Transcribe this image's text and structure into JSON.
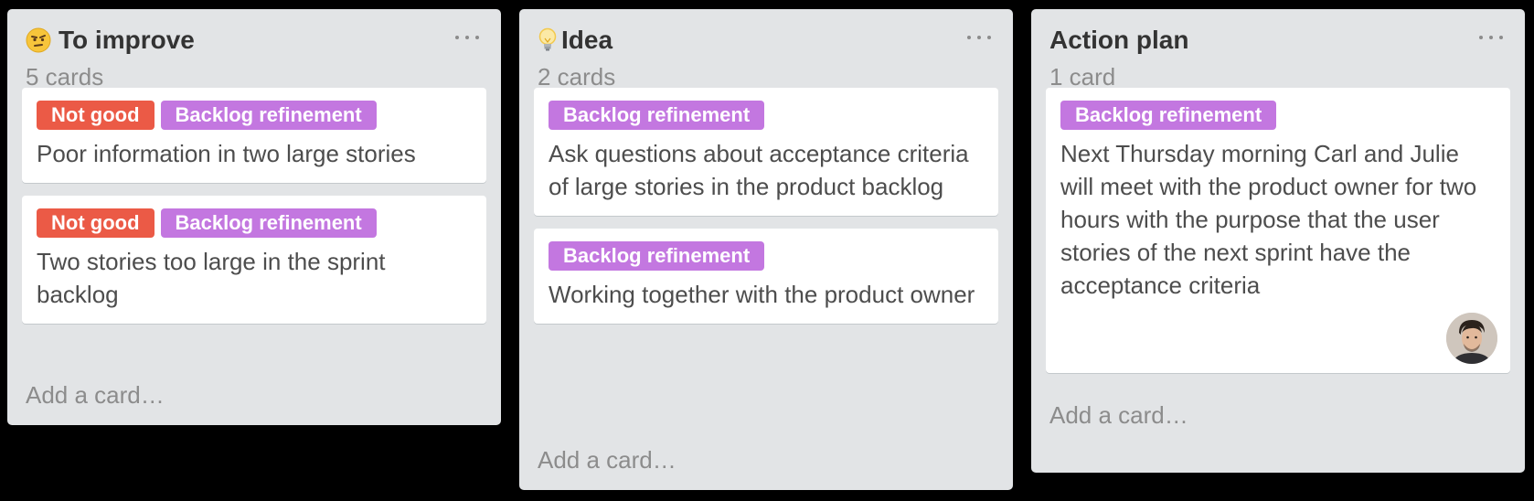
{
  "lists": [
    {
      "title": "To improve",
      "icon": "unimpressed-face-icon",
      "count": "5 cards",
      "cards": [
        {
          "labels": [
            {
              "text": "Not good",
              "color": "#eb5a46"
            },
            {
              "text": "Backlog refinement",
              "color": "#c377e0"
            }
          ],
          "text": "Poor information in two large stories"
        },
        {
          "labels": [
            {
              "text": "Not good",
              "color": "#eb5a46"
            },
            {
              "text": "Backlog refinement",
              "color": "#c377e0"
            }
          ],
          "text": "Two stories too large in the sprint backlog"
        }
      ],
      "add_card": "Add a card…"
    },
    {
      "title": "Idea",
      "icon": "lightbulb-icon",
      "count": "2 cards",
      "cards": [
        {
          "labels": [
            {
              "text": "Backlog refinement",
              "color": "#c377e0"
            }
          ],
          "text": "Ask questions about acceptance criteria of large stories in the product backlog"
        },
        {
          "labels": [
            {
              "text": "Backlog refinement",
              "color": "#c377e0"
            }
          ],
          "text": "Working together with the product owner"
        }
      ],
      "add_card": "Add a card…"
    },
    {
      "title": "Action plan",
      "icon": "",
      "count": "1 card",
      "cards": [
        {
          "labels": [
            {
              "text": "Backlog refinement",
              "color": "#c377e0"
            }
          ],
          "text": "Next Thursday morning Carl and Julie will meet with the product owner for two hours with the purpose that the user stories of the next sprint have the acceptance criteria",
          "avatar": "member-avatar"
        }
      ],
      "add_card": "Add a card…"
    }
  ],
  "colors": {
    "list_bg": "#e2e4e6",
    "label_red": "#eb5a46",
    "label_purple": "#c377e0",
    "board_bg": "#000000"
  }
}
